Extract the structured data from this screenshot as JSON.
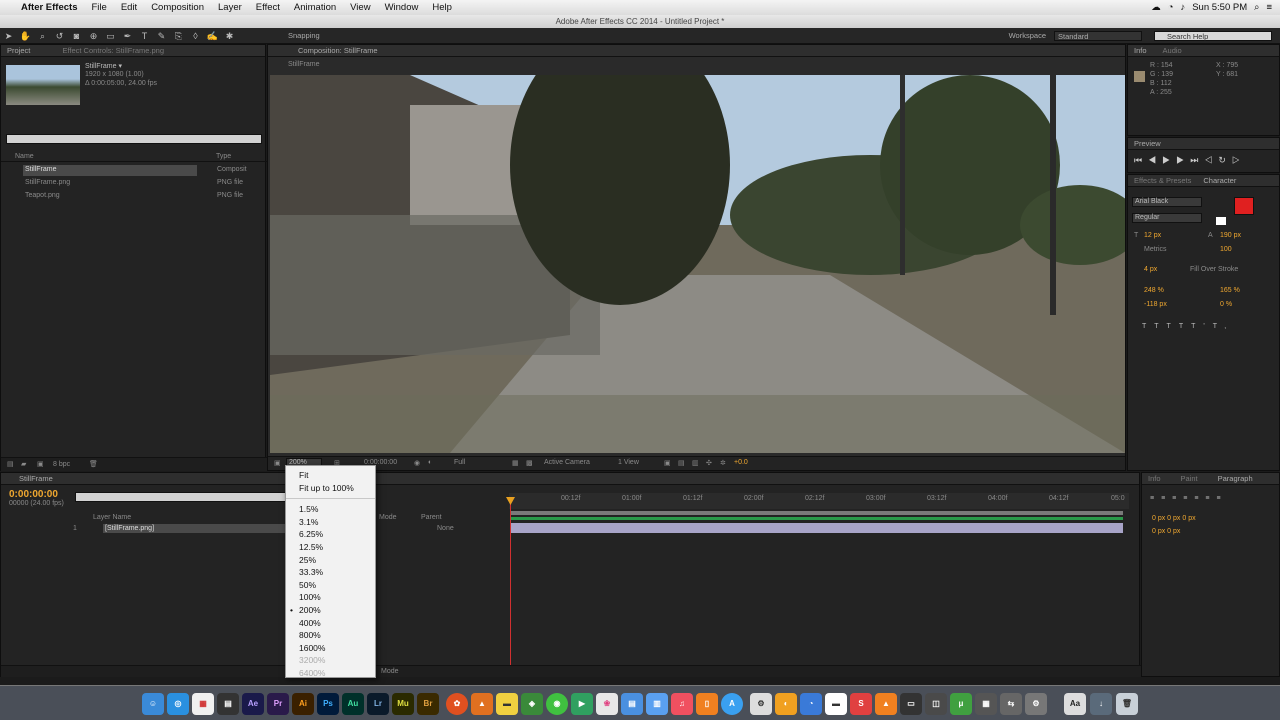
{
  "menubar": {
    "apple": "",
    "app": "After Effects",
    "items": [
      "File",
      "Edit",
      "Composition",
      "Layer",
      "Effect",
      "Animation",
      "View",
      "Window",
      "Help"
    ],
    "clock": "Sun 5:50 PM"
  },
  "window": {
    "title": "Adobe After Effects CC 2014 - Untitled Project *"
  },
  "toolbar": {
    "snapping": "Snapping",
    "workspace_label": "Workspace",
    "workspace_value": "Standard",
    "search_placeholder": "Search Help"
  },
  "project": {
    "tab": "Project",
    "tab2": "Effect Controls: StillFrame.png",
    "item_name": "StillFrame ▾",
    "item_info1": "1920 x 1080 (1.00)",
    "item_info2": "Δ 0:00:05:00, 24.00 fps",
    "col_name": "Name",
    "col_type": "Type",
    "items": [
      {
        "name": "StillFrame",
        "type": "Composit"
      },
      {
        "name": "StillFrame.png",
        "type": "PNG file"
      },
      {
        "name": "Teapot.png",
        "type": "PNG file"
      }
    ],
    "bpc": "8 bpc"
  },
  "composition": {
    "tab": "Composition: StillFrame",
    "crumb": "StillFrame",
    "zoom": "200%",
    "time": "0:00:00:00",
    "quality": "Full",
    "camera": "Active Camera",
    "view": "1 View",
    "exposure": "+0.0"
  },
  "info": {
    "tab": "Info",
    "tab2": "Audio",
    "r": "R : 154",
    "g": "G : 139",
    "b": "B : 112",
    "a": "A : 255",
    "x": "X : 795",
    "y": "Y : 681"
  },
  "preview": {
    "tab": "Preview"
  },
  "character": {
    "tab": "Effects & Presets",
    "tab2": "Character",
    "font": "Arial Black",
    "style": "Regular",
    "size": "12 px",
    "leading": "190 px",
    "kern": "Metrics",
    "track": "100",
    "stroke": "4 px",
    "stroke_mode": "Fill Over Stroke",
    "vscale": "248 %",
    "hscale": "165 %",
    "baseline": "-118 px",
    "tsume": "0 %",
    "fill_color": "#e02020"
  },
  "paragraph": {
    "tab": "Info",
    "tab2": "Paint",
    "tab3": "Paragraph"
  },
  "timeline": {
    "tab": "StillFrame",
    "timecode": "0:00:00:00",
    "fps": "00000 (24.00 fps)",
    "col_layer": "Layer Name",
    "col_parent": "Parent",
    "col_mode": "Mode",
    "layer_num": "1",
    "layer_name": "[StillFrame.png]",
    "parent": "None",
    "ruler": [
      "00:12f",
      "01:00f",
      "01:12f",
      "02:00f",
      "02:12f",
      "03:00f",
      "03:12f",
      "04:00f",
      "04:12f",
      "05:0"
    ],
    "toggle": "Toggle Switches / Modes"
  },
  "zoom_menu": {
    "items": [
      "Fit",
      "Fit up to 100%",
      "1.5%",
      "3.1%",
      "6.25%",
      "12.5%",
      "25%",
      "33.3%",
      "50%",
      "100%",
      "200%",
      "400%",
      "800%",
      "1600%",
      "3200%",
      "6400%"
    ],
    "selected": "200%",
    "disabled": [
      "3200%",
      "6400%"
    ]
  },
  "dock": {
    "apps": [
      "Finder",
      "Safari",
      "Calendar",
      "Clapper",
      "Ae",
      "Pr",
      "Ai",
      "Ps",
      "Au",
      "Lr",
      "Mu",
      "Br",
      "Blender",
      "VLC",
      "Notes",
      "Messages",
      "Maps",
      "Photos",
      "Preview",
      "Keynote",
      "Music",
      "iBooks",
      "App Store",
      "Skype",
      "Speech",
      "Vectr",
      "Tor",
      "Utorrent",
      "Calc",
      "Sys Prefs",
      "Dictionary",
      "Trash"
    ]
  }
}
